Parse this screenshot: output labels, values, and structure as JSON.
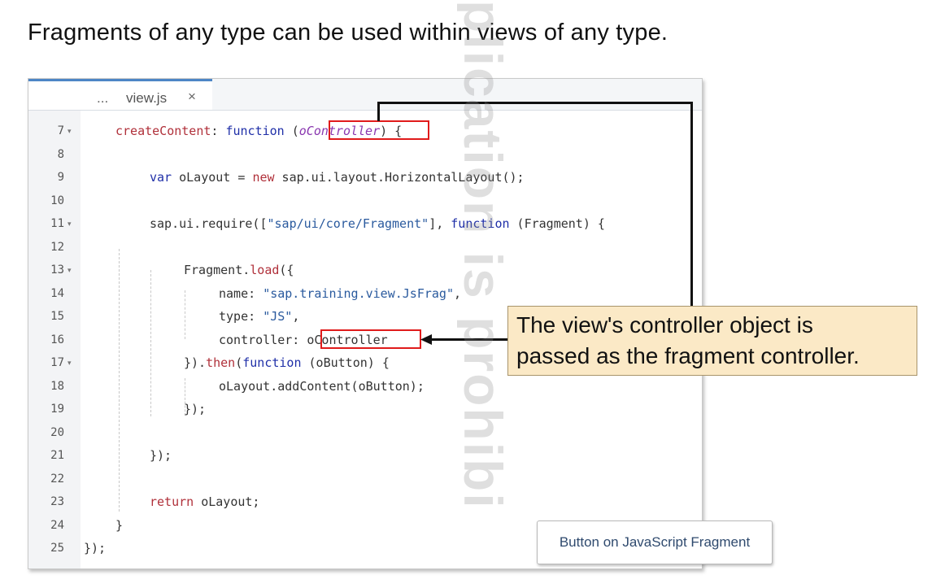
{
  "heading": "Fragments of any type can be used within views of any type.",
  "tab": {
    "dots": "...",
    "filename": "view.js",
    "close": "×"
  },
  "gutter": {
    "lines": [
      "7",
      "8",
      "9",
      "10",
      "11",
      "12",
      "13",
      "14",
      "15",
      "16",
      "17",
      "18",
      "19",
      "20",
      "21",
      "22",
      "23",
      "24",
      "25"
    ],
    "fold_marker": "▾"
  },
  "code": {
    "l7": {
      "name": "createContent",
      "colon": ": ",
      "kw": "function",
      "open": " (",
      "param": "oController",
      "close": ") {"
    },
    "l9": {
      "kw": "var",
      "mid": " oLayout = ",
      "new": "new",
      "rest": " sap.ui.layout.HorizontalLayout();"
    },
    "l11": {
      "start": "sap.ui.require([",
      "str": "\"sap/ui/core/Fragment\"",
      "mid": "], ",
      "kw": "function",
      "rest": " (Fragment) {"
    },
    "l13": {
      "start": "Fragment.",
      "fn": "load",
      "rest": "({"
    },
    "l14": {
      "key": "name: ",
      "str": "\"sap.training.view.JsFrag\"",
      "rest": ","
    },
    "l15": {
      "key": "type: ",
      "str": "\"JS\"",
      "rest": ","
    },
    "l16": {
      "key": "controller: ",
      "val": "oController"
    },
    "l17": {
      "start": "}).",
      "fn": "then",
      "open": "(",
      "kw": "function",
      "rest": " (oButton) {"
    },
    "l18": {
      "text": "oLayout.addContent(oButton);"
    },
    "l19": {
      "text": "});"
    },
    "l21": {
      "text": "});"
    },
    "l23": {
      "kw": "return",
      "rest": " oLayout;"
    },
    "l24": {
      "text": "}"
    },
    "l25": {
      "text": "});"
    }
  },
  "callout": {
    "line1": "The view's controller object is",
    "line2": "passed as the fragment controller."
  },
  "fragment_button": "Button on JavaScript Fragment",
  "watermark": "plication is prohibi",
  "colors": {
    "keyword": "#1f2fa8",
    "highlight_box": "#e01b1b",
    "callout_bg": "#fbe9c6",
    "tab_accent": "#4d86c6"
  }
}
